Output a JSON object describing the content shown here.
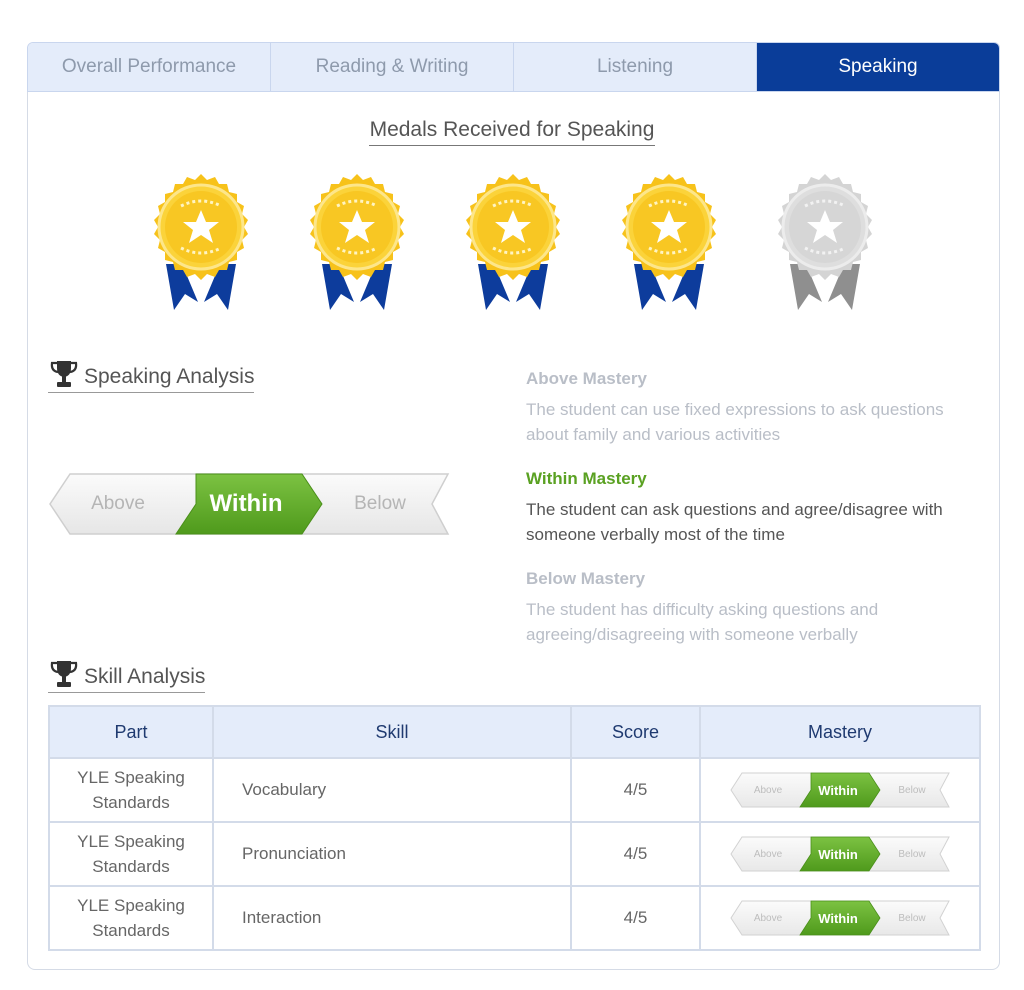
{
  "tabs": [
    {
      "label": "Overall Performance",
      "active": false
    },
    {
      "label": "Reading & Writing",
      "active": false
    },
    {
      "label": "Listening",
      "active": false
    },
    {
      "label": "Speaking",
      "active": true
    }
  ],
  "medals": {
    "title": "Medals Received for Speaking",
    "earned": 4,
    "total": 5
  },
  "speaking_analysis": {
    "title": "Speaking Analysis",
    "scale": {
      "above": "Above",
      "within": "Within",
      "below": "Below",
      "selected": "within"
    },
    "levels": [
      {
        "heading": "Above Mastery",
        "text": "The student can use fixed expressions to ask questions about family and various activities",
        "active": false
      },
      {
        "heading": "Within Mastery",
        "text": "The student can ask questions and agree/disagree with someone verbally most of the time",
        "active": true
      },
      {
        "heading": "Below Mastery",
        "text": "The student has difficulty asking questions and agreeing/disagreeing with someone verbally",
        "active": false
      }
    ]
  },
  "skill_analysis": {
    "title": "Skill Analysis",
    "headers": {
      "part": "Part",
      "skill": "Skill",
      "score": "Score",
      "mastery": "Mastery"
    },
    "rows": [
      {
        "part": "YLE Speaking Standards",
        "skill": "Vocabulary",
        "score": "4/5",
        "mastery": "within"
      },
      {
        "part": "YLE Speaking Standards",
        "skill": "Pronunciation",
        "score": "4/5",
        "mastery": "within"
      },
      {
        "part": "YLE Speaking Standards",
        "skill": "Interaction",
        "score": "4/5",
        "mastery": "within"
      }
    ],
    "scale_labels": {
      "above": "Above",
      "within": "Within",
      "below": "Below"
    }
  },
  "colors": {
    "tab_active": "#0a3d99",
    "tab_inactive": "#e4ecfa",
    "mastery_green": "#5aa122",
    "medal_gold": "#f7c21a",
    "ribbon_blue": "#0d3c9c",
    "medal_grey": "#d4d4d4"
  },
  "icons": {
    "trophy": "trophy-icon",
    "medal": "medal-icon",
    "star": "star-icon"
  }
}
